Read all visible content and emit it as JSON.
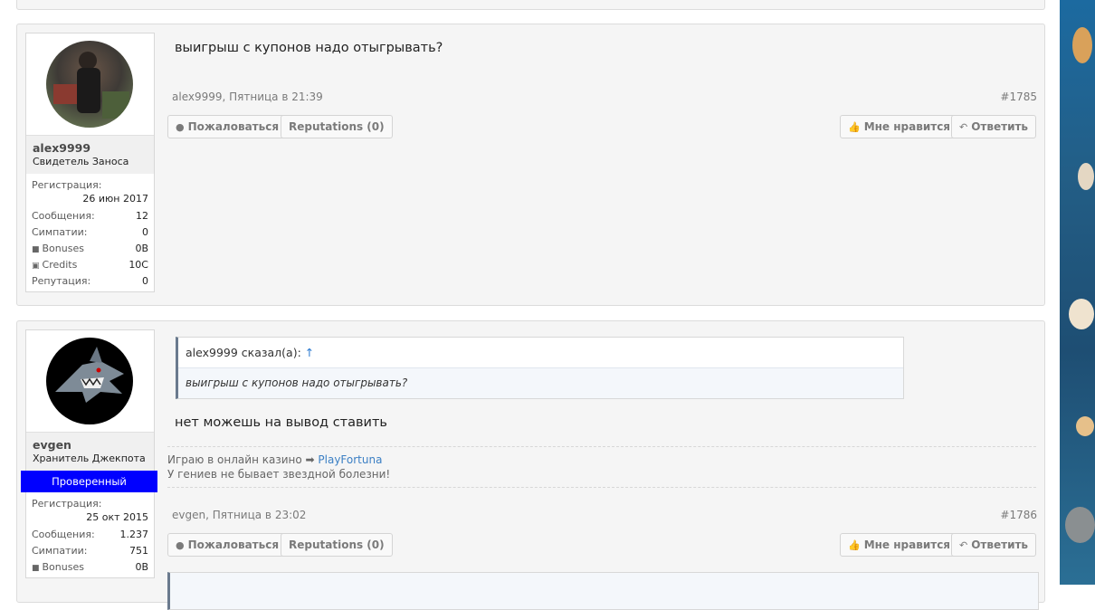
{
  "posts": [
    {
      "user": {
        "name": "alex9999",
        "title": "Свидетель Заноса",
        "verified": "",
        "stats": {
          "reg_label": "Регистрация:",
          "reg_date": "26 июн 2017",
          "messages_label": "Сообщения:",
          "messages": "12",
          "likes_label": "Симпатии:",
          "likes": "0",
          "bonuses_label": "Bonuses",
          "bonuses": "0B",
          "credits_label": "Credits",
          "credits": "10C",
          "reputation_label": "Репутация:",
          "reputation": "0"
        }
      },
      "message": "выигрыш с купонов надо отыгрывать?",
      "meta": "alex9999, Пятница в 21:39",
      "number": "#1785",
      "buttons": {
        "report": "Пожаловаться",
        "reputations": "Reputations (0)",
        "like": "Мне нравится",
        "reply": "Ответить"
      }
    },
    {
      "user": {
        "name": "evgen",
        "title": "Хранитель Джекпота",
        "verified": "Проверенный",
        "stats": {
          "reg_label": "Регистрация:",
          "reg_date": "25 окт 2015",
          "messages_label": "Сообщения:",
          "messages": "1.237",
          "likes_label": "Симпатии:",
          "likes": "751",
          "bonuses_label": "Bonuses",
          "bonuses": "0B"
        }
      },
      "quote": {
        "author": "alex9999 сказал(а):",
        "arrow": "↑",
        "text": "выигрыш с купонов надо отыгрывать?"
      },
      "message": "нет можешь на вывод ставить",
      "signature": {
        "line1_prefix": "Играю в онлайн казино ➡",
        "line1_link": "PlayFortuna",
        "line2": "У гениев не бывает звездной болезни!"
      },
      "meta": "evgen, Пятница в 23:02",
      "number": "#1786",
      "buttons": {
        "report": "Пожаловаться",
        "reputations": "Reputations (0)",
        "like": "Мне нравится",
        "reply": "Ответить"
      }
    }
  ],
  "icons": {
    "report": "exclamation-circle-icon",
    "like": "thumbs-up-icon",
    "reply": "reply-icon",
    "bonuses": "gift-icon",
    "credits": "money-icon"
  },
  "colors": {
    "verified_badge": "#0000ff",
    "link": "#3b7fc4",
    "quote_arrow": "#2d7bd1"
  }
}
